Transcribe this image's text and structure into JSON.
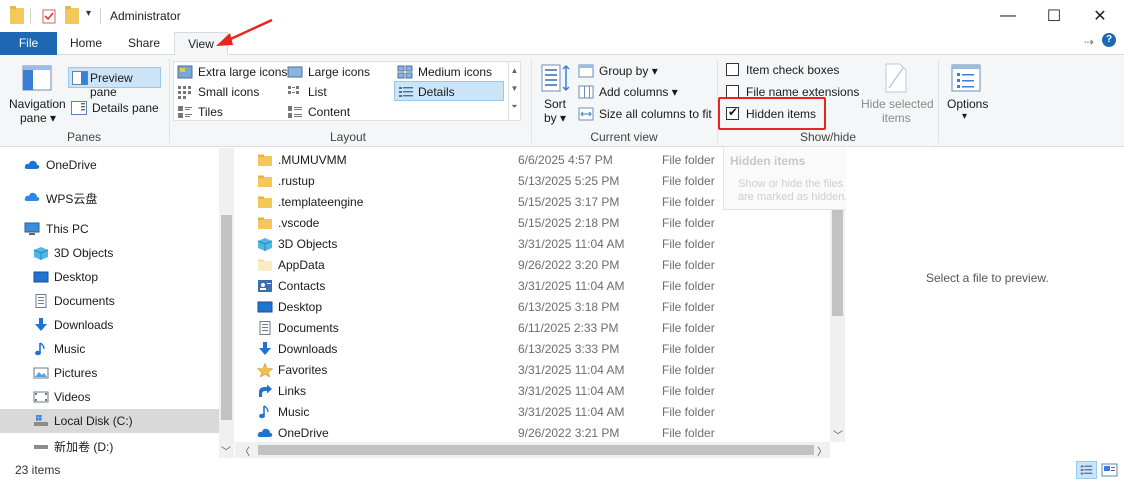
{
  "window": {
    "title": "Administrator",
    "controls": {
      "minimize": "—",
      "maximize": "☐",
      "close": "✕"
    }
  },
  "tabs": [
    {
      "label": "File"
    },
    {
      "label": "Home"
    },
    {
      "label": "Share"
    },
    {
      "label": "View"
    }
  ],
  "ribbon_right": {
    "pin": "⇢",
    "help": "?"
  },
  "ribbon": {
    "panes": {
      "group_label": "Panes",
      "navigation_pane": "Navigation",
      "navigation_pane_2": "pane ▾",
      "preview_pane": "Preview pane",
      "details_pane": "Details pane"
    },
    "layout": {
      "group_label": "Layout",
      "items": [
        {
          "label": "Extra large icons"
        },
        {
          "label": "Large icons"
        },
        {
          "label": "Medium icons"
        },
        {
          "label": "Small icons"
        },
        {
          "label": "List"
        },
        {
          "label": "Details"
        },
        {
          "label": "Tiles"
        },
        {
          "label": "Content"
        }
      ]
    },
    "current_view": {
      "group_label": "Current view",
      "sort_by": "Sort",
      "sort_by_2": "by ▾",
      "group_by": "Group by ▾",
      "add_columns": "Add columns ▾",
      "size_columns": "Size all columns to fit"
    },
    "show_hide": {
      "group_label": "Show/hide",
      "item_check_boxes": "Item check boxes",
      "file_name_extensions": "File name extensions",
      "hidden_items": "Hidden items",
      "hide_selected": "Hide selected",
      "hide_selected_2": "items"
    },
    "options": {
      "label": "Options",
      "arrow": "▾"
    }
  },
  "tooltip": {
    "title": "Hidden items",
    "description": "Show or hide the files and folders that are marked as hidden."
  },
  "nav": {
    "items": [
      {
        "label": "OneDrive",
        "icon": "cloud-icon"
      },
      {
        "label": "WPS云盘",
        "icon": "cloud-icon"
      },
      {
        "label": "This PC",
        "icon": "computer-icon"
      },
      {
        "label": "3D Objects",
        "icon": "cube-icon"
      },
      {
        "label": "Desktop",
        "icon": "desktop-icon"
      },
      {
        "label": "Documents",
        "icon": "document-icon"
      },
      {
        "label": "Downloads",
        "icon": "download-icon"
      },
      {
        "label": "Music",
        "icon": "music-icon"
      },
      {
        "label": "Pictures",
        "icon": "picture-icon"
      },
      {
        "label": "Videos",
        "icon": "video-icon"
      },
      {
        "label": "Local Disk (C:)",
        "icon": "drive-icon"
      },
      {
        "label": "新加卷 (D:)",
        "icon": "drive-icon"
      }
    ]
  },
  "files": [
    {
      "name": ".MUMUVMM",
      "date": "6/6/2025 4:57 PM",
      "type": "File folder",
      "icon": "folder-icon"
    },
    {
      "name": ".rustup",
      "date": "5/13/2025 5:25 PM",
      "type": "File folder",
      "icon": "folder-icon"
    },
    {
      "name": ".templateengine",
      "date": "5/15/2025 3:17 PM",
      "type": "File folder",
      "icon": "folder-icon"
    },
    {
      "name": ".vscode",
      "date": "5/15/2025 2:18 PM",
      "type": "File folder",
      "icon": "folder-icon"
    },
    {
      "name": "3D Objects",
      "date": "3/31/2025 11:04 AM",
      "type": "File folder",
      "icon": "cube-icon"
    },
    {
      "name": "AppData",
      "date": "9/26/2022 3:20 PM",
      "type": "File folder",
      "icon": "faded-folder-icon"
    },
    {
      "name": "Contacts",
      "date": "3/31/2025 11:04 AM",
      "type": "File folder",
      "icon": "contacts-icon"
    },
    {
      "name": "Desktop",
      "date": "6/13/2025 3:18 PM",
      "type": "File folder",
      "icon": "desktop-icon"
    },
    {
      "name": "Documents",
      "date": "6/11/2025 2:33 PM",
      "type": "File folder",
      "icon": "document-icon"
    },
    {
      "name": "Downloads",
      "date": "6/13/2025 3:33 PM",
      "type": "File folder",
      "icon": "download-icon"
    },
    {
      "name": "Favorites",
      "date": "3/31/2025 11:04 AM",
      "type": "File folder",
      "icon": "star-icon"
    },
    {
      "name": "Links",
      "date": "3/31/2025 11:04 AM",
      "type": "File folder",
      "icon": "link-icon"
    },
    {
      "name": "Music",
      "date": "3/31/2025 11:04 AM",
      "type": "File folder",
      "icon": "music-icon"
    },
    {
      "name": "OneDrive",
      "date": "9/26/2022 3:21 PM",
      "type": "File folder",
      "icon": "cloud-icon"
    }
  ],
  "preview": {
    "text": "Select a file to preview."
  },
  "status": {
    "count": "23 items"
  },
  "colors": {
    "accent": "#1e67b5",
    "highlight": "#e8261d",
    "selection": "#cce4f7",
    "folder": "#f4c75a"
  }
}
